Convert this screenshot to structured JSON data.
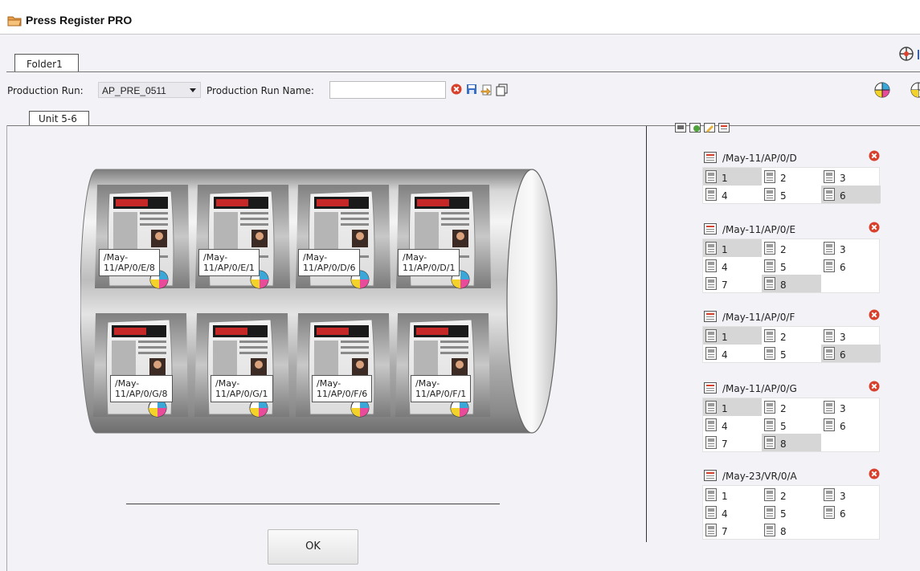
{
  "app": {
    "title": "Press Register PRO"
  },
  "folder_tab": "Folder1",
  "toolbar": {
    "production_run_label": "Production Run:",
    "production_run_value": "AP_PRE_0511",
    "production_run_name_label": "Production Run Name:",
    "production_run_name_value": ""
  },
  "unit_tab": "Unit 5-6",
  "plates": [
    {
      "label_line1": "/May-",
      "label_line2": "11/AP/0/E/8"
    },
    {
      "label_line1": "/May-",
      "label_line2": "11/AP/0/E/1"
    },
    {
      "label_line1": "/May-",
      "label_line2": "11/AP/0/D/6"
    },
    {
      "label_line1": "/May-",
      "label_line2": "11/AP/0/D/1"
    },
    {
      "label_line1": "/May-",
      "label_line2": "11/AP/0/G/8"
    },
    {
      "label_line1": "/May-",
      "label_line2": "11/AP/0/G/1"
    },
    {
      "label_line1": "/May-",
      "label_line2": "11/AP/0/F/6"
    },
    {
      "label_line1": "/May-",
      "label_line2": "11/AP/0/F/1"
    }
  ],
  "ok_button": "OK",
  "page_groups": [
    {
      "title": "/May-11/AP/0/D",
      "pages": [
        "1",
        "2",
        "3",
        "4",
        "5",
        "6"
      ],
      "selected": [
        0,
        5
      ]
    },
    {
      "title": "/May-11/AP/0/E",
      "pages": [
        "1",
        "2",
        "3",
        "4",
        "5",
        "6",
        "7",
        "8"
      ],
      "selected": [
        0,
        7
      ]
    },
    {
      "title": "/May-11/AP/0/F",
      "pages": [
        "1",
        "2",
        "3",
        "4",
        "5",
        "6"
      ],
      "selected": [
        0,
        5
      ]
    },
    {
      "title": "/May-11/AP/0/G",
      "pages": [
        "1",
        "2",
        "3",
        "4",
        "5",
        "6",
        "7",
        "8"
      ],
      "selected": [
        0,
        7
      ]
    },
    {
      "title": "/May-23/VR/0/A",
      "pages": [
        "1",
        "2",
        "3",
        "4",
        "5",
        "6",
        "7",
        "8"
      ],
      "selected": []
    }
  ],
  "colors": {
    "accent_red": "#d9402b",
    "selected_cell": "#d6d6d6",
    "workarea": "#f2f2f7"
  }
}
